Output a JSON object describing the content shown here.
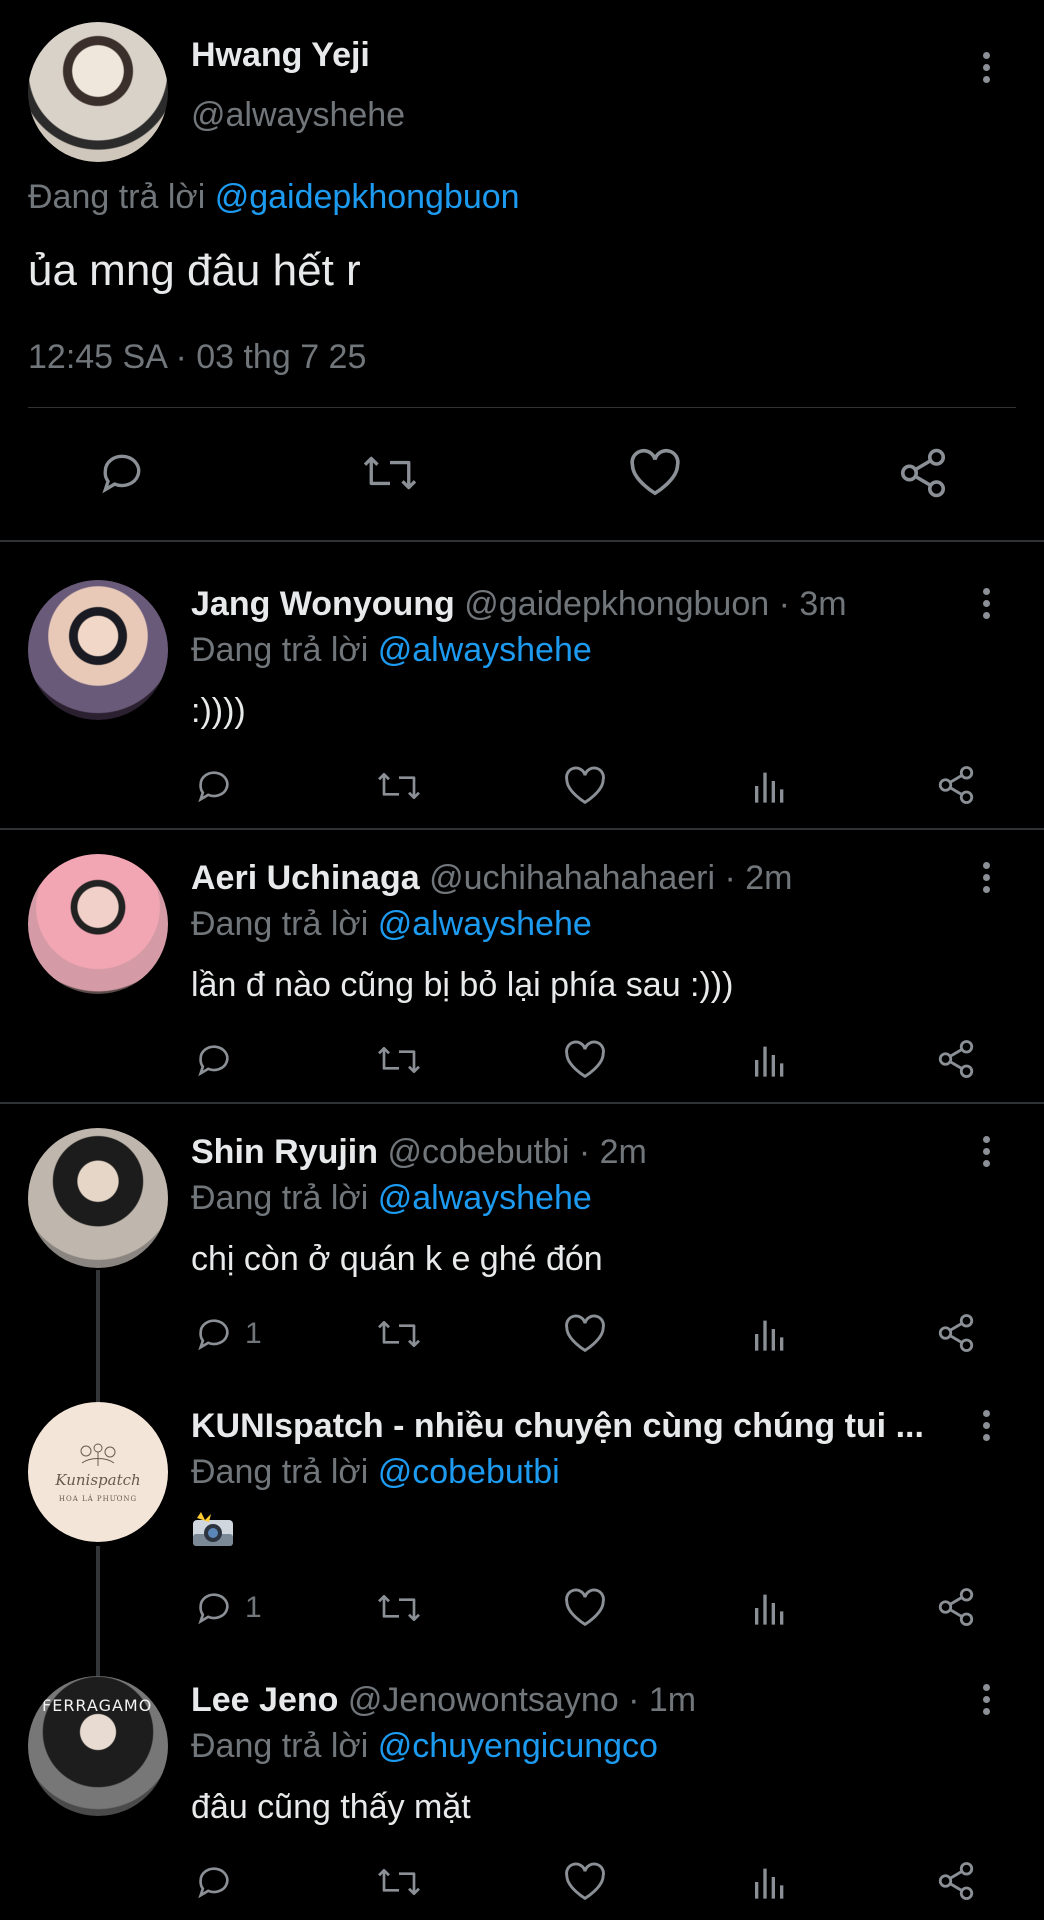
{
  "main_tweet": {
    "author_name": "Hwang Yeji",
    "author_handle": "@alwayshehe",
    "reply_prefix": "Đang trả lời ",
    "reply_to": "@gaidepkhongbuon",
    "text": "ủa mng đâu hết r",
    "timestamp": "12:45 SA · 03 thg 7 25"
  },
  "replies": [
    {
      "name": "Jang Wonyoung",
      "handle": "@gaidepkhongbuon",
      "time": " · 3m",
      "reply_prefix": "Đang trả lời ",
      "reply_to": "@alwayshehe",
      "text": ":))))",
      "reply_count": ""
    },
    {
      "name": "Aeri Uchinaga",
      "handle": "@uchihahahahaeri",
      "time": " · 2m",
      "reply_prefix": "Đang trả lời ",
      "reply_to": "@alwayshehe",
      "text": "lần đ nào cũng bị bỏ lại phía sau :)))",
      "reply_count": ""
    },
    {
      "name": "Shin Ryujin",
      "handle": "@cobebutbi",
      "time": " · 2m",
      "reply_prefix": "Đang trả lời ",
      "reply_to": "@alwayshehe",
      "text": "chị còn ở quán k e ghé đón",
      "reply_count": "1"
    },
    {
      "name": "KUNIspatch - nhiều chuyện cùng chúng tui ...",
      "handle": "",
      "time": "",
      "reply_prefix": "Đang trả lời ",
      "reply_to": "@cobebutbi",
      "text": "",
      "media": "camera-flash-emoji",
      "reply_count": "1",
      "avatar_logo": "Kunispatch",
      "avatar_sub": "HOA LÁ PHƯƠNG"
    },
    {
      "name": "Lee Jeno",
      "handle": "@Jenowontsayno",
      "time": " · 1m",
      "reply_prefix": "Đang trả lời ",
      "reply_to": "@chuyengicungco",
      "text": "đâu cũng thấy mặt",
      "reply_count": "",
      "avatar_text": "FERRAGAMO"
    }
  ],
  "colors": {
    "background": "#000000",
    "text": "#e7e9ea",
    "muted": "#71767b",
    "link": "#1d9bf0",
    "separator": "#2f3336"
  }
}
